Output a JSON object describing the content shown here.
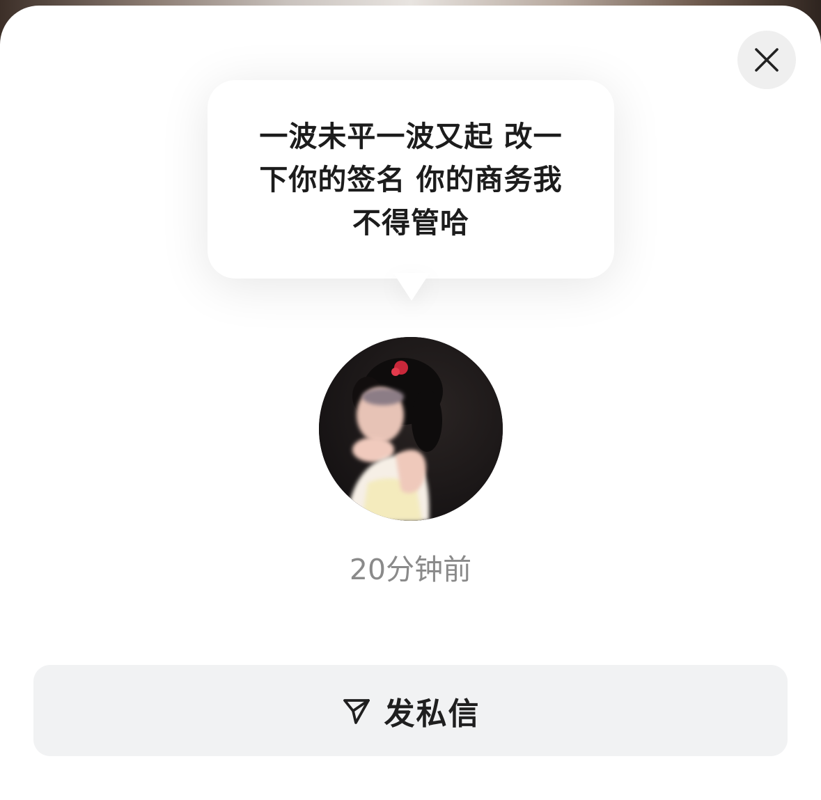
{
  "status": {
    "text": "一波未平一波又起 改一下你的签名 你的商务我不得管哈"
  },
  "profile": {
    "last_active": "20分钟前"
  },
  "actions": {
    "message_label": "发私信"
  },
  "icons": {
    "close": "close-icon",
    "send": "send-icon"
  },
  "colors": {
    "sheet_bg": "#ffffff",
    "button_bg": "#f1f2f3",
    "secondary_text": "#8a8a8a"
  }
}
